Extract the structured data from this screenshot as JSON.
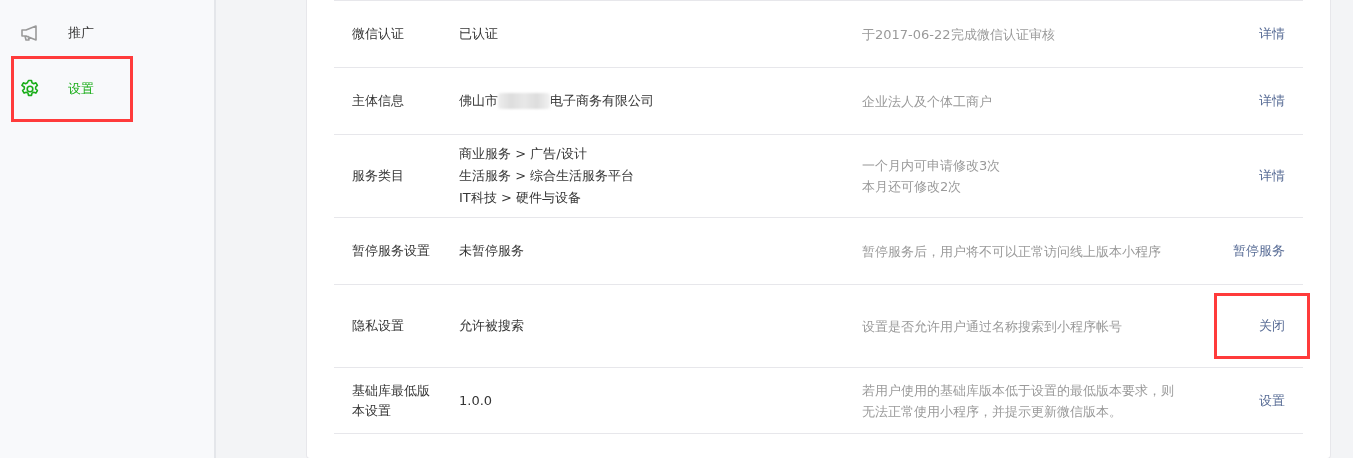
{
  "sidebar": {
    "items": [
      {
        "label": "推广",
        "kind": "promote",
        "selected": false,
        "highlighted": false
      },
      {
        "label": "设置",
        "kind": "settings",
        "selected": true,
        "highlighted": true
      }
    ]
  },
  "settings": {
    "rows": [
      {
        "label": "微信认证",
        "value_lines": [
          [
            {
              "kind": "text",
              "text": "已认证"
            }
          ]
        ],
        "description": [
          "于2017-06-22完成微信认证审核"
        ],
        "action": "详情",
        "highlighted": false
      },
      {
        "label": "主体信息",
        "value_lines": [
          [
            {
              "kind": "text",
              "text": "佛山市"
            },
            {
              "kind": "redacted"
            },
            {
              "kind": "text",
              "text": "电子商务有限公司"
            }
          ]
        ],
        "description": [
          "企业法人及个体工商户"
        ],
        "action": "详情",
        "highlighted": false
      },
      {
        "label": "服务类目",
        "value_lines": [
          [
            {
              "kind": "text",
              "text": "商业服务 > 广告/设计"
            }
          ],
          [
            {
              "kind": "text",
              "text": "生活服务 > 综合生活服务平台"
            }
          ],
          [
            {
              "kind": "text",
              "text": "IT科技 > 硬件与设备"
            }
          ]
        ],
        "description": [
          "一个月内可申请修改3次",
          "本月还可修改2次"
        ],
        "action": "详情",
        "highlighted": false
      },
      {
        "label": "暂停服务设置",
        "value_lines": [
          [
            {
              "kind": "text",
              "text": "未暂停服务"
            }
          ]
        ],
        "description": [
          "暂停服务后，用户将不可以正常访问线上版本小程序"
        ],
        "action": "暂停服务",
        "highlighted": false
      },
      {
        "label": "隐私设置",
        "value_lines": [
          [
            {
              "kind": "text",
              "text": "允许被搜索"
            }
          ]
        ],
        "description": [
          "设置是否允许用户通过名称搜索到小程序帐号"
        ],
        "action": "关闭",
        "highlighted": true
      },
      {
        "label": "基础库最低版本设置",
        "value_lines": [
          [
            {
              "kind": "text",
              "text": "1.0.0"
            }
          ]
        ],
        "description": [
          "若用户使用的基础库版本低于设置的最低版本要求，则",
          "无法正常使用小程序，并提示更新微信版本。"
        ],
        "action": "设置",
        "highlighted": false
      }
    ]
  }
}
